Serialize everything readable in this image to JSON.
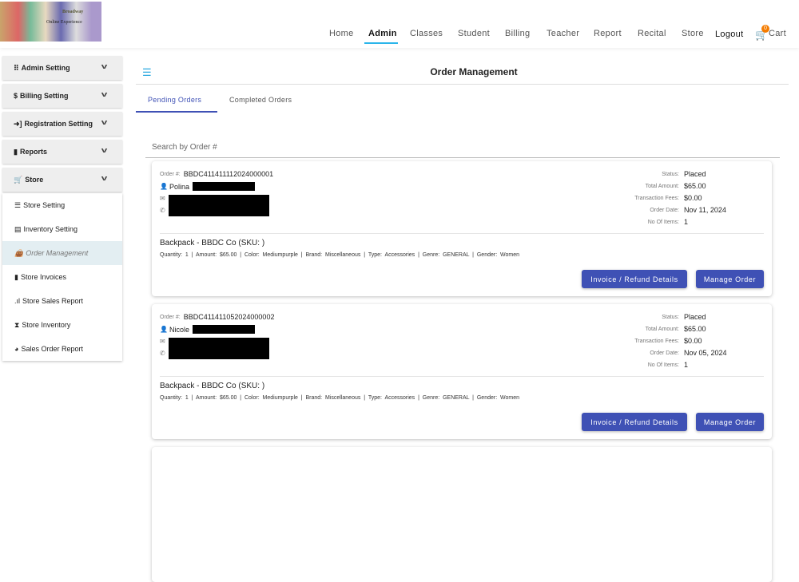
{
  "header": {
    "logo_text": [
      "Broadway",
      "Online Experience"
    ],
    "nav": [
      "Home",
      "Admin",
      "Classes",
      "Student",
      "Billing",
      "Teacher",
      "Report",
      "Recital",
      "Store"
    ],
    "logout": "Logout",
    "cart": "Cart",
    "cart_count": "0"
  },
  "sidebar": {
    "sections": [
      "Admin Setting",
      "Billing Setting",
      "Registration Setting",
      "Reports",
      "Store"
    ],
    "store_items": [
      "Store Setting",
      "Inventory Setting",
      "Order Management",
      "Store Invoices",
      "Store Sales Report",
      "Store Inventory",
      "Sales Order Report"
    ]
  },
  "main": {
    "title": "Order Management",
    "tabs": [
      "Pending Orders",
      "Completed Orders"
    ],
    "search_placeholder": "Search by Order #"
  },
  "labels": {
    "order": "Order #:",
    "status": "Status:",
    "total": "Total Amount:",
    "fees": "Transaction Fees:",
    "date": "Order Date:",
    "items": "No Of Items:",
    "invoice_btn": "Invoice / Refund Details",
    "manage_btn": "Manage Order"
  },
  "orders": [
    {
      "number": "BBDC411411112024000001",
      "name": "Polina",
      "status": "Placed",
      "total": "$65.00",
      "fees": "$0.00",
      "date": "Nov 11, 2024",
      "items": "1",
      "product": "Backpack - BBDC Co (SKU: )",
      "details": "Quantity:  1  |  Amount:  $65.00  |  Color:  Mediumpurple  |  Brand:  Miscellaneous  |  Type:  Accessories  |  Genre:  GENERAL  |  Gender:  Women"
    },
    {
      "number": "BBDC411411052024000002",
      "name": "Nicole",
      "status": "Placed",
      "total": "$65.00",
      "fees": "$0.00",
      "date": "Nov 05, 2024",
      "items": "1",
      "product": "Backpack - BBDC Co (SKU: )",
      "details": "Quantity:  1  |  Amount:  $65.00  |  Color:  Mediumpurple  |  Brand:  Miscellaneous  |  Type:  Accessories  |  Genre:  GENERAL  |  Gender:  Women"
    }
  ]
}
